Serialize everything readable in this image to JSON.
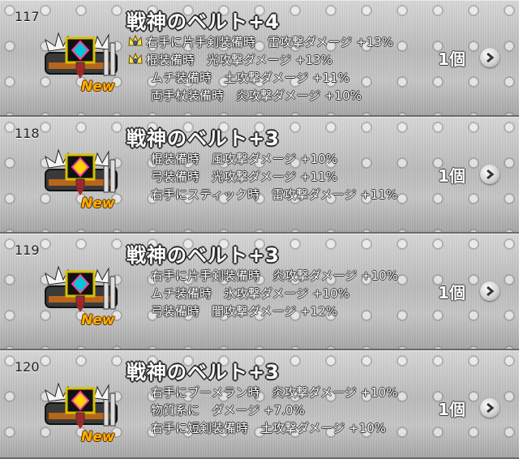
{
  "items": [
    {
      "number": "117",
      "name": "戦神のベルト+4",
      "quantity": "1個",
      "badge": "New",
      "effects": [
        {
          "text": "右手に片手剣装備時　雷攻撃ダメージ +13%",
          "icon": "crown-icon"
        },
        {
          "text": "棍装備時　光攻撃ダメージ +13%",
          "icon": "crown-icon"
        },
        {
          "text": "ムチ装備時　土攻撃ダメージ +11%",
          "icon": ""
        },
        {
          "text": "両手杖装備時　炎攻撃ダメージ +10%",
          "icon": ""
        }
      ]
    },
    {
      "number": "118",
      "name": "戦神のベルト+3",
      "quantity": "1個",
      "badge": "New",
      "effects": [
        {
          "text": "棍装備時　風攻撃ダメージ +10%",
          "icon": ""
        },
        {
          "text": "弓装備時　光攻撃ダメージ +11%",
          "icon": ""
        },
        {
          "text": "右手にスティック時　雷攻撃ダメージ +11%",
          "icon": ""
        }
      ]
    },
    {
      "number": "119",
      "name": "戦神のベルト+3",
      "quantity": "1個",
      "badge": "New",
      "effects": [
        {
          "text": "右手に片手剣装備時　炎攻撃ダメージ +10%",
          "icon": ""
        },
        {
          "text": "ムチ装備時　氷攻撃ダメージ +10%",
          "icon": ""
        },
        {
          "text": "弓装備時　闇攻撃ダメージ +12%",
          "icon": ""
        }
      ]
    },
    {
      "number": "120",
      "name": "戦神のベルト+3",
      "quantity": "1個",
      "badge": "New",
      "effects": [
        {
          "text": "右手にブーメラン時　炎攻撃ダメージ +10%",
          "icon": ""
        },
        {
          "text": "物質系に　ダメージ +7.0%",
          "icon": ""
        },
        {
          "text": "右手に短剣装備時　土攻撃ダメージ +10%",
          "icon": ""
        }
      ]
    }
  ],
  "colors": {
    "title_text": "#ffffff",
    "outline": "#2a2a2a",
    "new_badge": "#ffb000",
    "row_background": "#c4c4c4"
  }
}
